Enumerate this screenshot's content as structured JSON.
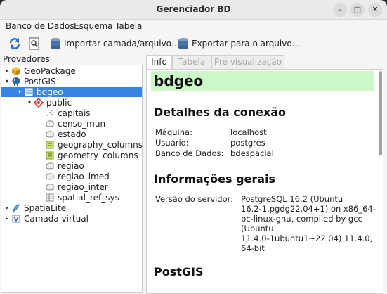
{
  "window": {
    "title": "Gerenciador BD"
  },
  "menu": [
    {
      "label": "Banco de Dados",
      "ul": "B",
      "rest": "anco de Dados"
    },
    {
      "label": "Esquema",
      "ul": "E",
      "rest": "squema"
    },
    {
      "label": "Tabela",
      "ul": "T",
      "rest": "abela"
    }
  ],
  "toolbar": {
    "import_label": "Importar camada/arquivo…",
    "export_label": "Exportar para o arquivo…"
  },
  "providers": {
    "header": "Provedores",
    "items": [
      {
        "label": "GeoPackage",
        "icon": "geopackage-icon",
        "arrow": "▸"
      },
      {
        "label": "PostGIS",
        "icon": "postgis-icon",
        "arrow": "▾"
      },
      {
        "label": "bdgeo",
        "icon": "database-icon",
        "arrow": "▾"
      },
      {
        "label": "public",
        "icon": "schema-icon",
        "arrow": "▾"
      },
      {
        "label": "capitais",
        "icon": "point-layer-icon"
      },
      {
        "label": "censo_mun",
        "icon": "table-icon"
      },
      {
        "label": "estado",
        "icon": "table-icon"
      },
      {
        "label": "geography_columns",
        "icon": "view-icon"
      },
      {
        "label": "geometry_columns",
        "icon": "view-icon"
      },
      {
        "label": "regiao",
        "icon": "table-icon"
      },
      {
        "label": "regiao_imed",
        "icon": "table-icon"
      },
      {
        "label": "regiao_inter",
        "icon": "table-icon"
      },
      {
        "label": "spatial_ref_sys",
        "icon": "grid-table-icon"
      },
      {
        "label": "SpatiaLite",
        "icon": "spatialite-icon",
        "arrow": "▸"
      },
      {
        "label": "Camada virtual",
        "icon": "virtual-layer-icon",
        "arrow": "▸"
      }
    ]
  },
  "tabs": [
    {
      "label": "Info",
      "active": true
    },
    {
      "label": "Tabela",
      "active": false
    },
    {
      "label": "Pré visualização",
      "active": false
    }
  ],
  "info": {
    "db_name": "bdgeo",
    "connection_heading": "Detalhes da conexão",
    "host_label": "Máquina:",
    "host_value": "localhost",
    "user_label": "Usuário:",
    "user_value": "postgres",
    "db_label": "Banco de Dados:",
    "db_value": "bdespacial",
    "general_heading": "Informações gerais",
    "server_label": "Versão do servidor:",
    "server_value_lines": [
      "PostgreSQL 16.2 (Ubuntu",
      "16.2-1.pgdg22.04+1) on x86_64-",
      "pc-linux-gnu, compiled by gcc",
      "(Ubuntu",
      "11.4.0-1ubuntu1~22.04) 11.4.0,",
      "64-bit"
    ],
    "postgis_heading": "PostGIS"
  },
  "colors": {
    "selection": "#3584e4",
    "title_highlight": "#ccf7c9"
  }
}
